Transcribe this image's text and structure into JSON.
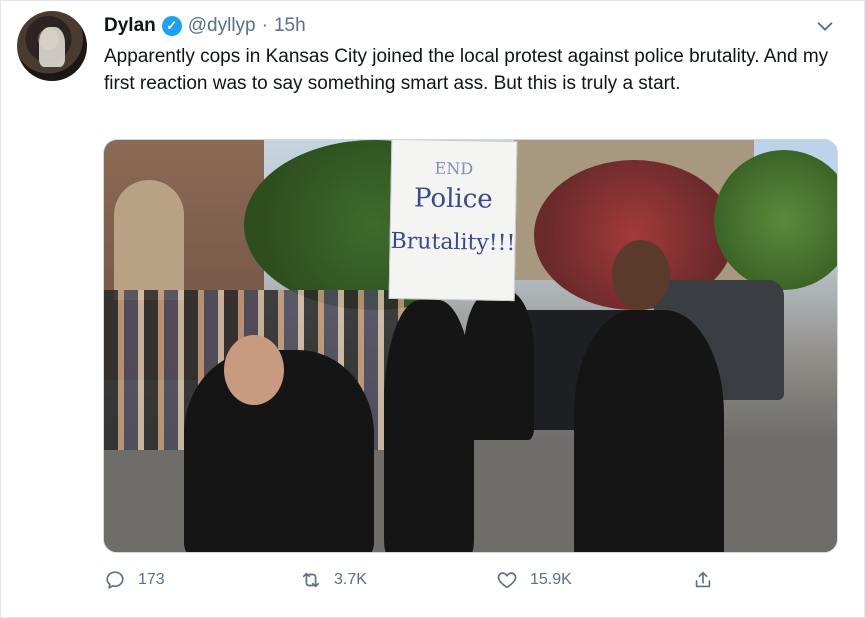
{
  "tweet": {
    "author_name": "Dylan",
    "handle": "@dyllyp",
    "separator": "·",
    "time": "15h",
    "text": "Apparently cops in Kansas City joined the local protest against police brutality. And my first reaction was to say something smart ass. But this is truly a start."
  },
  "media": {
    "sign_lines": [
      "END",
      "Police",
      "Brutality!!!"
    ]
  },
  "actions": {
    "replies": "173",
    "retweets": "3.7K",
    "likes": "15.9K"
  },
  "colors": {
    "verified": "#1da1f2",
    "secondary_text": "#5b7083"
  },
  "icons": {
    "verified": "verified-badge-icon",
    "more": "chevron-down-icon",
    "reply": "reply-icon",
    "retweet": "retweet-icon",
    "like": "heart-icon",
    "share": "share-icon"
  }
}
